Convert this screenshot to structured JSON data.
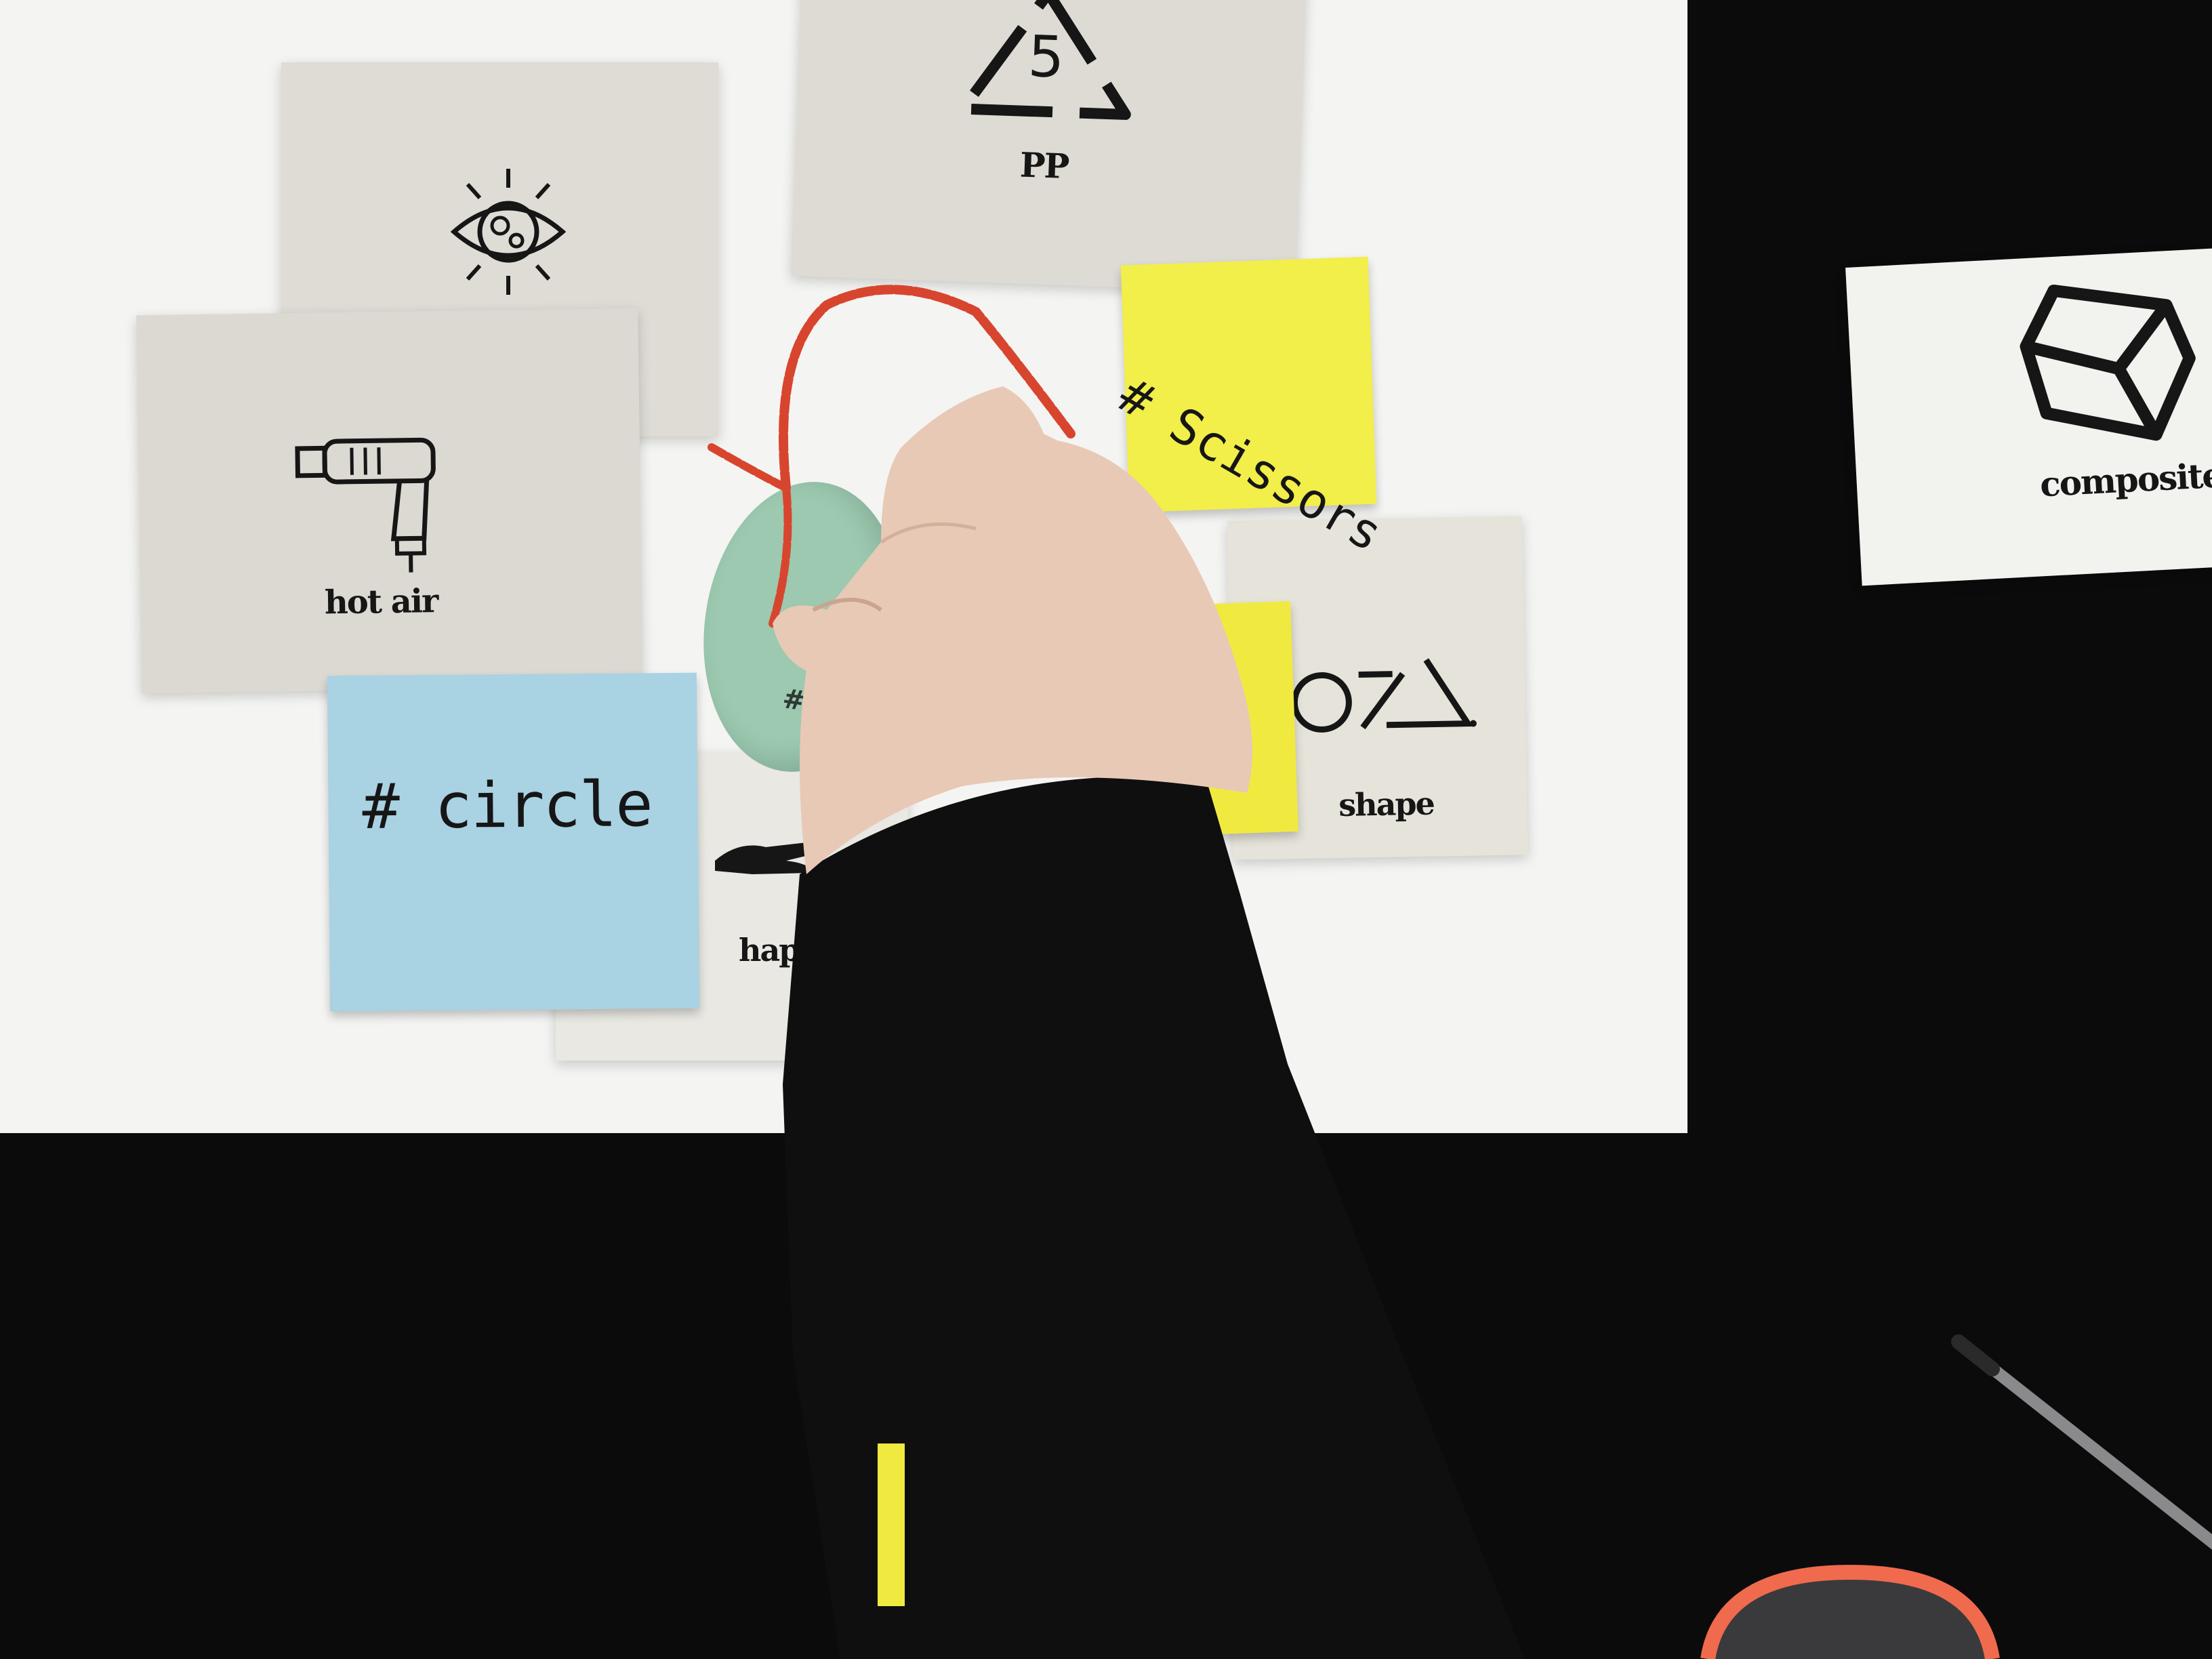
{
  "scene": {
    "description_tag": "workshop table with cards and sticky notes",
    "colors": {
      "table": "#0b0b0c",
      "paper": "#f4f4f2",
      "card_grey": "#dcdad3",
      "card_white": "#f2f2ee",
      "sticky_yellow": "#f2ee4a",
      "sticky_blue": "#a9d2e3",
      "string_red": "#d8452e",
      "disc_green": "#9cc9b0",
      "sleeve_black": "#0f0f10",
      "skin": "#e8c9b6"
    }
  },
  "cards": {
    "recycle": {
      "number": "5",
      "label": "PP",
      "icon": "recycle-triangle-icon"
    },
    "eye": {
      "icon": "eye-icon"
    },
    "hot_air": {
      "label": "hot air",
      "icon": "heat-gun-icon"
    },
    "shape": {
      "label": "shape",
      "icon": "shapes-icon"
    },
    "composite": {
      "label": "composite",
      "icon": "cube-icon"
    },
    "haptic": {
      "label": "hap",
      "icon": "hand-icon"
    }
  },
  "sticky_notes": {
    "scissors": {
      "text": "# Scissors"
    },
    "circle": {
      "text": "# circle"
    },
    "disc_tag": {
      "text": "#m"
    }
  }
}
